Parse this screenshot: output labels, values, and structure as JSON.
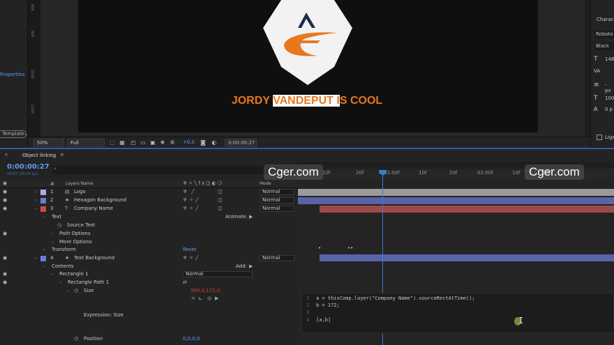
{
  "left_panel": {
    "properties_link": "Properties",
    "template_button": "Template..."
  },
  "ruler_numbers": [
    "600",
    "800",
    "1000",
    "1200"
  ],
  "composition": {
    "title_part1": "JORDY ",
    "title_highlight": "VANDEPUT I",
    "title_part2": "S COOL",
    "bg_color": "#0f0f0f",
    "accent_color": "#e8781e"
  },
  "character_panel": {
    "header": "Characte",
    "font": "Roboto",
    "style": "Black",
    "size": "148",
    "leading": "- px",
    "scale": "100",
    "baseline": "0 p",
    "ligatures": "Liga"
  },
  "viewer_bar": {
    "zoom": "50%",
    "resolution": "Full",
    "exposure": "+0,0",
    "timecode": "0:00:00:27"
  },
  "timeline": {
    "tab_title": "Object linking",
    "current_time": "0:00:00:27",
    "frame_info": "00027 (30.00 fps)",
    "col_layer_name": "Layers Name",
    "col_mode": "Mode",
    "ruler_ticks": [
      "10f",
      "20f",
      "01:00f",
      "10f",
      "20f",
      "02:00f",
      "10f",
      "20f"
    ]
  },
  "layers": [
    {
      "num": "1",
      "name": "Logo",
      "mode": "Normal",
      "color": "#b8a6e6"
    },
    {
      "num": "2",
      "name": "Hexagon Background",
      "mode": "Normal",
      "color": "#6d7bd6"
    },
    {
      "num": "3",
      "name": "Company Name",
      "mode": "Normal",
      "color": "#c94a4a"
    },
    {
      "num": "4",
      "name": "Text Background",
      "mode": "Normal",
      "color": "#6d7bd6"
    }
  ],
  "props": {
    "text": "Text",
    "animate": "Animate:",
    "source_text": "Source Text",
    "path_options": "Path Options",
    "more_options": "More Options",
    "transform": "Transform",
    "reset": "Reset",
    "contents": "Contents",
    "add": "Add:",
    "rectangle1": "Rectangle 1",
    "rect_mode": "Normal",
    "rectangle_path1": "Rectangle Path 1",
    "size": "Size",
    "size_value": "900,0,172,0",
    "expression_size": "Expression: Size",
    "position": "Position",
    "position_value": "0,0,0,0"
  },
  "expression": {
    "lines": [
      {
        "n": "1",
        "code": "a = thisComp.layer(\"Company Name\").sourceRectAtTime();"
      },
      {
        "n": "2",
        "code": "b = 172;"
      },
      {
        "n": "3",
        "code": ""
      },
      {
        "n": "4",
        "code": "[a,b]"
      }
    ]
  },
  "watermarks": {
    "left": "Cger.com",
    "right": "Cger.com"
  }
}
